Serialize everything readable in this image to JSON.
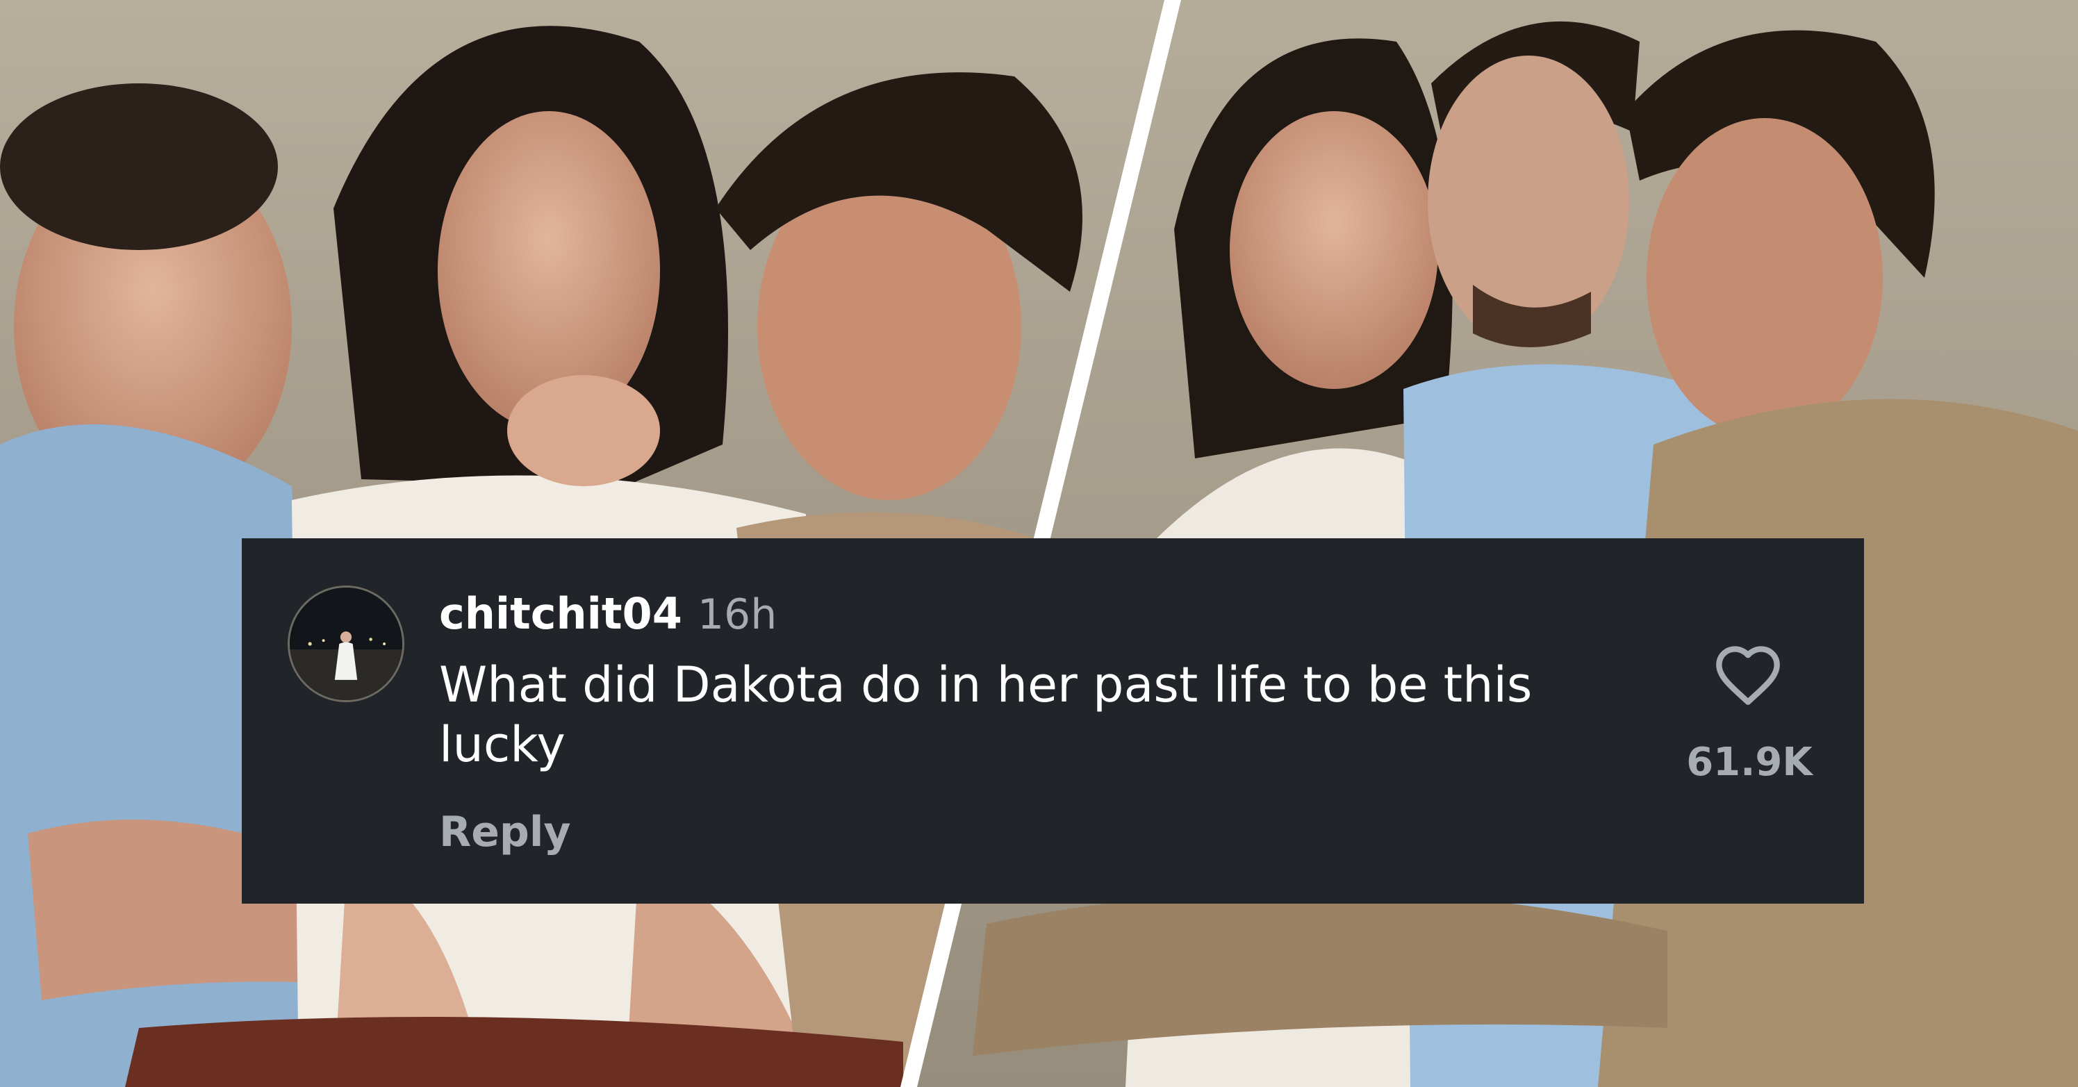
{
  "comment": {
    "username": "chitchit04",
    "timestamp": "16h",
    "text": "What did Dakota do in her past life to be this lucky",
    "reply_label": "Reply",
    "like_count": "61.9K",
    "like_icon": "heart-outline-icon"
  },
  "colors": {
    "card_background": "#212429",
    "primary_text": "#ffffff",
    "secondary_text": "#a7abb2",
    "divider": "#ffffff"
  }
}
